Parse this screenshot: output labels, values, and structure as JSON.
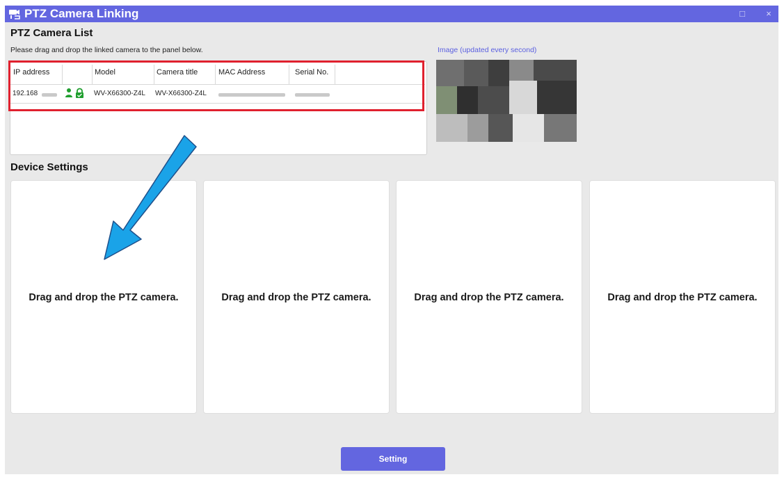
{
  "window": {
    "title": "PTZ Camera Linking",
    "maximize_glyph": "□",
    "close_glyph": "×",
    "app_icon": "camera-link-icon"
  },
  "camera_list": {
    "heading": "PTZ Camera List",
    "instruction": "Please drag and drop the linked camera to the panel below.",
    "columns": [
      "IP address",
      "",
      "Model",
      "Camera title",
      "MAC Address",
      "Serial No."
    ],
    "rows": [
      {
        "ip": "192.168",
        "status_icon": "user-lock-icon",
        "model": "WV-X66300-Z4L",
        "title": "WV-X66300-Z4L"
      }
    ],
    "image_caption": "Image (updated every second)"
  },
  "device_settings": {
    "heading": "Device Settings",
    "panels": [
      {
        "label": "Drag and drop the PTZ camera."
      },
      {
        "label": "Drag and drop the PTZ camera."
      },
      {
        "label": "Drag and drop the PTZ camera."
      },
      {
        "label": "Drag and drop the PTZ camera."
      }
    ]
  },
  "buttons": {
    "setting": "Setting"
  },
  "colors": {
    "accent": "#6366e0",
    "highlight": "#e0202e",
    "arrow": "#1aa3e8",
    "status_icon": "#1f9e2e"
  }
}
